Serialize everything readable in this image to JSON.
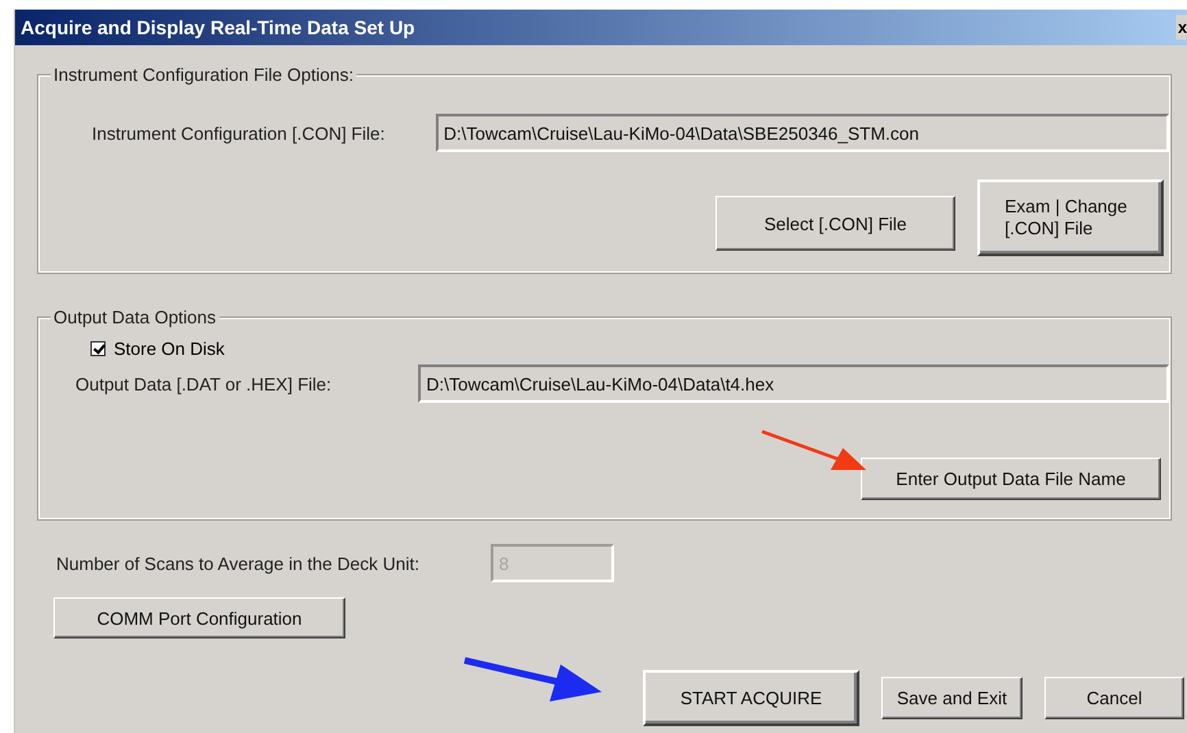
{
  "window": {
    "title": "Acquire and Display Real-Time Data Set Up",
    "close": "x"
  },
  "instrument_group": {
    "legend": "Instrument Configuration File Options:",
    "label": "Instrument Configuration [.CON] File:",
    "value": "D:\\Towcam\\Cruise\\Lau-KiMo-04\\Data\\SBE250346_STM.con",
    "buttons": [
      {
        "label": "Select [.CON] File",
        "kind": "flat"
      },
      {
        "label": "Exam | Change [.CON] File",
        "kind": "raised"
      }
    ]
  },
  "output_group": {
    "legend": "Output Data Options",
    "checkbox": {
      "label": "Store On Disk",
      "checked": true
    },
    "label": "Output Data [.DAT or .HEX] File:",
    "value": "D:\\Towcam\\Cruise\\Lau-KiMo-04\\Data\\t4.hex",
    "button": "Enter Output Data File Name"
  },
  "scans": {
    "label": "Number of Scans to Average in the Deck Unit:",
    "value": "8",
    "disabled": true
  },
  "comm_button": "COMM Port Configuration",
  "buttons": [
    {
      "label": "START ACQUIRE",
      "kind": "raised"
    },
    {
      "label": "Save and Exit",
      "kind": "flat"
    },
    {
      "label": "Cancel",
      "kind": "flat"
    }
  ]
}
